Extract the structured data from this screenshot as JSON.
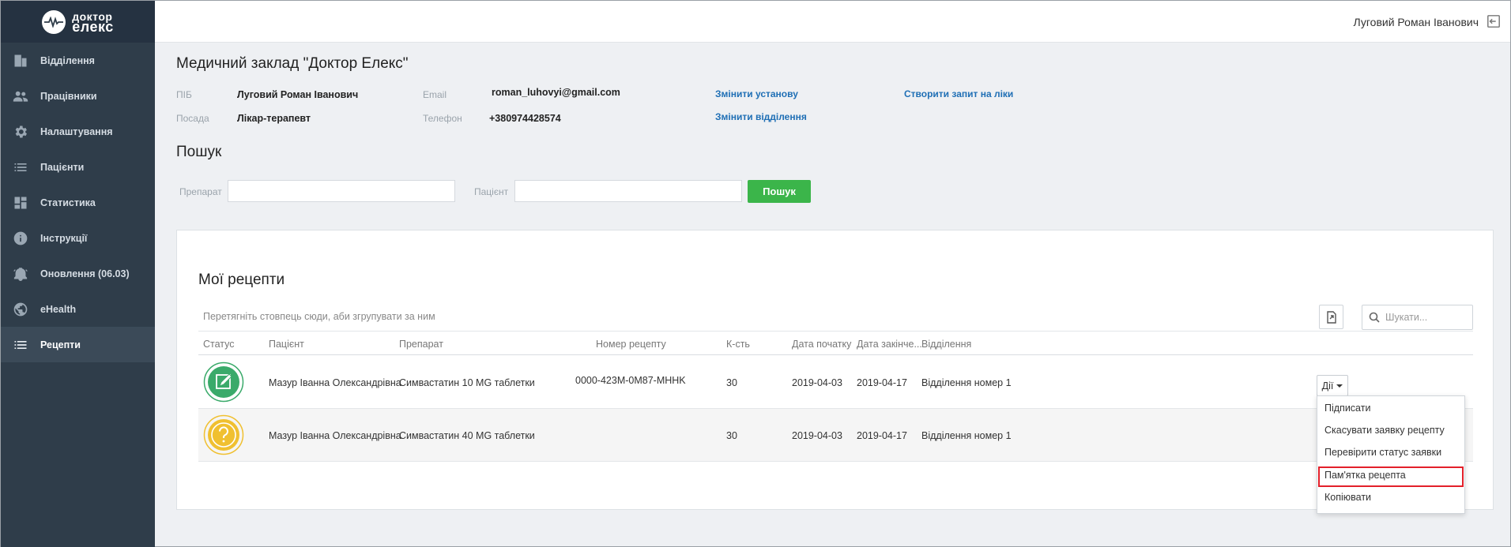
{
  "brand": {
    "line1": "доктор",
    "line2": "елекс"
  },
  "sidebar": {
    "items": [
      {
        "label": "Відділення",
        "icon": "building-icon"
      },
      {
        "label": "Працівники",
        "icon": "people-icon"
      },
      {
        "label": "Налаштування",
        "icon": "gear-icon"
      },
      {
        "label": "Пацієнти",
        "icon": "list-icon"
      },
      {
        "label": "Статистика",
        "icon": "dashboard-icon"
      },
      {
        "label": "Інструкції",
        "icon": "info-icon"
      },
      {
        "label": "Оновлення (06.03)",
        "icon": "bell-icon"
      },
      {
        "label": "eHealth",
        "icon": "globe-icon"
      },
      {
        "label": "Рецепти",
        "icon": "list-icon",
        "active": true
      }
    ]
  },
  "header": {
    "user_name": "Луговий Роман Іванович"
  },
  "org": {
    "title": "Медичний заклад \"Доктор Елекс\"",
    "name_label": "ПІБ",
    "name_value": "Луговий Роман Іванович",
    "position_label": "Посада",
    "position_value": "Лікар-терапевт",
    "email_label": "Email",
    "email_value": "roman_luhovyi@gmail.com",
    "phone_label": "Телефон",
    "phone_value": "+380974428574",
    "change_institution": "Змінити установу",
    "change_department": "Змінити відділення",
    "create_request": "Створити запит на ліки"
  },
  "search": {
    "title": "Пошук",
    "drug_label": "Препарат",
    "patient_label": "Пацієнт",
    "button": "Пошук"
  },
  "recipes": {
    "title": "Мої рецепти",
    "group_hint": "Перетягніть стовпець сюди, аби згрупувати за ним",
    "search_placeholder": "Шукати...",
    "columns": {
      "status": "Статус",
      "patient": "Пацієнт",
      "drug": "Препарат",
      "number": "Номер рецепту",
      "qty": "К-сть",
      "start": "Дата початку",
      "end": "Дата закінче...",
      "department": "Відділення"
    },
    "rows": [
      {
        "status": "signed",
        "patient": "Мазур Іванна Олександрівна",
        "drug": "Симвастатин 10 MG таблетки",
        "number": "0000-423M-0M87-MHHK",
        "qty": "30",
        "start": "2019-04-03",
        "end": "2019-04-17",
        "department": "Відділення номер 1"
      },
      {
        "status": "pending",
        "patient": "Мазур Іванна Олександрівна",
        "drug": "Симвастатин 40 MG таблетки",
        "number": "",
        "qty": "30",
        "start": "2019-04-03",
        "end": "2019-04-17",
        "department": "Відділення номер 1"
      }
    ],
    "actions_label": "Дії",
    "actions_menu": [
      "Підписати",
      "Скасувати заявку рецепту",
      "Перевірити статус заявки",
      "Пам'ятка рецепта",
      "Копіювати"
    ]
  },
  "colors": {
    "sidebar": "#2f3d4a",
    "accent_green": "#3bb54a",
    "link": "#1f6fb5",
    "highlight": "#e3202a",
    "status_signed": "#3aaa6a",
    "status_pending": "#f0c030"
  }
}
